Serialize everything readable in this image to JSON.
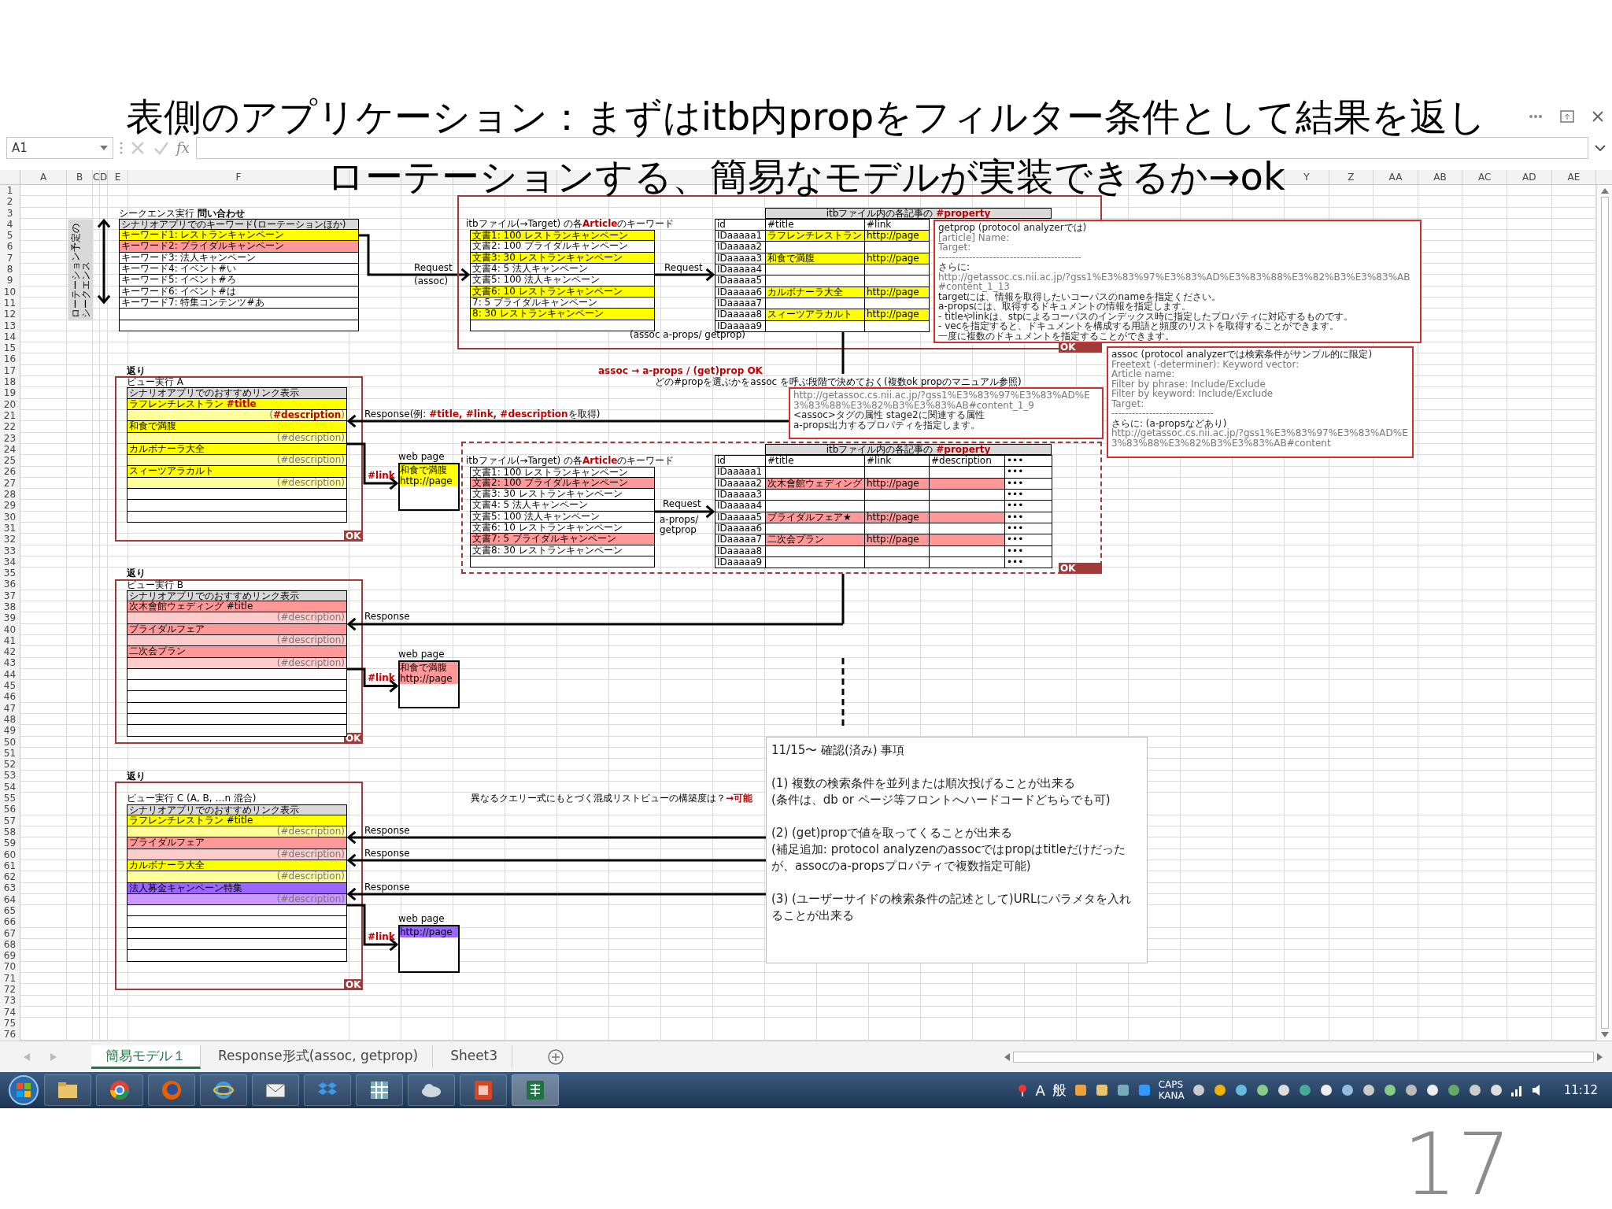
{
  "slide_title_lines": [
    "表側のアプリケーション：まずはitb内propをフィルター条件として結果を返し",
    "ローテーションする、簡易なモデルが実装できるか→ok"
  ],
  "name_box": "A1",
  "formula_fx": "fx",
  "column_headers_left": [
    "A",
    "B",
    "C",
    "D",
    "E",
    "F"
  ],
  "column_headers_right": [
    "Y",
    "Z",
    "AA",
    "AB",
    "AC",
    "AD",
    "AE"
  ],
  "row_numbers": [
    "1",
    "2",
    "3",
    "4",
    "5",
    "6",
    "7",
    "8",
    "9",
    "10",
    "11",
    "12",
    "13",
    "14",
    "15",
    "16",
    "17",
    "18",
    "19",
    "20",
    "21",
    "22",
    "23",
    "24",
    "25",
    "26",
    "27",
    "28",
    "29",
    "30",
    "31",
    "32",
    "33",
    "34",
    "35",
    "36",
    "37",
    "38",
    "39",
    "40",
    "41",
    "42",
    "43",
    "44",
    "45",
    "46",
    "47",
    "48",
    "49",
    "50",
    "51",
    "52",
    "53",
    "54",
    "55",
    "56",
    "57",
    "58",
    "59",
    "60",
    "61",
    "62",
    "63",
    "64",
    "65",
    "66",
    "67",
    "68",
    "69",
    "70",
    "71",
    "72",
    "73",
    "74",
    "75",
    "76"
  ],
  "sequence": {
    "heading": "シークエンス実行 **問い合わせ**",
    "rotation_label": "ローテーション予定のシークエンス",
    "request_labels": [
      "Request",
      "(assoc)"
    ],
    "rows": [
      {
        "kind": "header",
        "text": "シナリオアプリでのキーワード(ローテーションほか)"
      },
      {
        "kind": "item",
        "text": "キーワード1: レストランキャンペーン",
        "color": "#ffff00"
      },
      {
        "kind": "item",
        "text": "キーワード2: ブライダルキャンペーン",
        "color": "#ff9999"
      },
      {
        "kind": "item",
        "text": "キーワード3: 法人キャンペーン",
        "color": "#ffffff"
      },
      {
        "kind": "item",
        "text": "キーワード4: イベント#い",
        "color": "#ffffff"
      },
      {
        "kind": "item",
        "text": "キーワード5: イベント#ろ",
        "color": "#ffffff"
      },
      {
        "kind": "item",
        "text": "キーワード6: イベント#は",
        "color": "#ffffff"
      },
      {
        "kind": "item",
        "text": "キーワード7: 特集コンテンツ#あ",
        "color": "#ffffff"
      },
      {
        "kind": "empty"
      },
      {
        "kind": "empty"
      }
    ]
  },
  "assoc_note": {
    "lines": [
      {
        "kind": "label",
        "text": "assoc (protocol analyzerでは検索条件がサンプル的に限定)"
      },
      {
        "kind": "field",
        "text": "Freetext (-determiner): Keyword vector:"
      },
      {
        "kind": "field",
        "text": "Article name:"
      },
      {
        "kind": "field",
        "text": "Filter by phrase: Include/Exclude"
      },
      {
        "kind": "field",
        "text": "Filter by keyword: Include/Exclude"
      },
      {
        "kind": "field",
        "text": "Target:"
      },
      {
        "kind": "rule",
        "text": "------------------------------"
      },
      {
        "kind": "label",
        "text": "さらに: (a-propsなどあり)"
      },
      {
        "kind": "url",
        "text": "http://getassoc.cs.nii.ac.jp/?gss1%E3%83%97%E3%83%AD%E3%83%88%E3%82%B3%E3%83%AB#content"
      }
    ]
  },
  "stage_1": {
    "article_heading": "itbファイル(→Target) の各**Article**のキーワード",
    "articles": [
      {
        "kind": "item",
        "text": "文書1: 100 レストランキャンペーン",
        "color": "#ffff00"
      },
      {
        "kind": "item",
        "text": "文書2: 100 ブライダルキャンペーン",
        "color": "#ffffff"
      },
      {
        "kind": "item",
        "text": "文書3: 30 レストランキャンペーン",
        "color": "#ffff00"
      },
      {
        "kind": "item",
        "text": "文書4: 5 法人キャンペーン",
        "color": "#ffffff"
      },
      {
        "kind": "item",
        "text": "文書5: 100 法人キャンペーン",
        "color": "#ffffff"
      },
      {
        "kind": "item",
        "text": "文書6: 10 レストランキャンペーン",
        "color": "#ffff00"
      },
      {
        "kind": "item",
        "text": "7: 5 ブライダルキャンペーン",
        "color": "#ffffff"
      },
      {
        "kind": "item",
        "text": "8: 30 レストランキャンペーン",
        "color": "#ffff00"
      },
      {
        "kind": "empty"
      }
    ],
    "request_labels": [
      "Request"
    ],
    "property_heading": "itbファイル内の各記事の **#property**",
    "columns": [
      "id",
      "#title",
      "#link"
    ],
    "properties": [
      {
        "id": "IDaaaaa1",
        "title": "ラフレンチレストラン",
        "link": "http://page",
        "color": "#ffff00"
      },
      {
        "id": "IDaaaaa2",
        "color": "#ffffff"
      },
      {
        "id": "IDaaaaa3",
        "title": "和食で満腹",
        "link": "http://page",
        "color": "#ffff00"
      },
      {
        "id": "IDaaaaa4",
        "color": "#ffffff"
      },
      {
        "id": "IDaaaaa5",
        "color": "#ffffff"
      },
      {
        "id": "IDaaaaa6",
        "title": "カルボナーラ大全",
        "link": "http://page",
        "color": "#ffff00"
      },
      {
        "id": "IDaaaaa7",
        "color": "#ffffff"
      },
      {
        "id": "IDaaaaa8",
        "title": "スィーツアラカルト",
        "link": "http://page",
        "color": "#ffff00"
      },
      {
        "id": "IDaaaaa9",
        "color": "#ffffff"
      }
    ],
    "caption": "(assoc a-props/ getprop)",
    "status": "OK"
  },
  "getprop_note": {
    "lines": [
      {
        "kind": "label",
        "text": "getprop (protocol analyzerでは)"
      },
      {
        "kind": "field",
        "text": "[article] Name:"
      },
      {
        "kind": "field",
        "text": "Target:"
      },
      {
        "kind": "rule",
        "text": "------------------------------------------"
      },
      {
        "kind": "label",
        "text": "さらに:"
      },
      {
        "kind": "url",
        "text": "http://getassoc.cs.nii.ac.jp/?gss1%E3%83%97%E3%83%AD%E3%83%88%E3%82%B3%E3%83%AB#content_1_13"
      },
      {
        "kind": "label",
        "text": "targetには、情報を取得したいコーパスのnameを指定ください。"
      },
      {
        "kind": "label",
        "text": "a-propsには、取得するドキュメントの情報を指定します。"
      },
      {
        "kind": "label",
        "text": " - titleやlinkは、stpによるコーパスのインデックス時に指定したプロパティに対応するものです。"
      },
      {
        "kind": "label",
        "text": " - vecを指定すると、ドキュメントを構成する用語と頻度のリストを取得することができます。"
      },
      {
        "kind": "label",
        "text": "一度に複数のドキュメントを指定することができます。"
      }
    ]
  },
  "result_note": {
    "summary": "assoc → a-props / (get)prop OK",
    "detail": "どの#propを選ぶかをassoc を呼ぶ段階で決めておく(複数ok propのマニュアル参照)"
  },
  "stage2_note": {
    "lines": [
      {
        "kind": "url",
        "text": "http://getassoc.cs.nii.ac.jp/?gss1%E3%83%97%E3%83%AD%E3%83%88%E3%82%B3%E3%83%AB#content_1_9"
      },
      {
        "kind": "label",
        "text": "<assoc>タグの属性  stage2に関連する属性"
      },
      {
        "kind": "label",
        "text": "a-props出力するプロパティを指定します。"
      }
    ]
  },
  "stage_2": {
    "article_heading": "itbファイル(→Target) の各**Article**のキーワード",
    "articles": [
      {
        "kind": "item",
        "text": "文書1: 100 レストランキャンペーン",
        "color": "#ffffff"
      },
      {
        "kind": "item",
        "text": "文書2: 100 ブライダルキャンペーン",
        "color": "#ff9999"
      },
      {
        "kind": "item",
        "text": "文書3: 30 レストランキャンペーン",
        "color": "#ffffff"
      },
      {
        "kind": "item",
        "text": "文書4: 5 法人キャンペーン",
        "color": "#ffffff"
      },
      {
        "kind": "item",
        "text": "文書5: 100 法人キャンペーン",
        "color": "#ffffff"
      },
      {
        "kind": "item",
        "text": "文書6: 10 レストランキャンペーン",
        "color": "#ffffff"
      },
      {
        "kind": "item",
        "text": "文書7: 5 ブライダルキャンペーン",
        "color": "#ff9999"
      },
      {
        "kind": "item",
        "text": "文書8: 30 レストランキャンペーン",
        "color": "#ffffff"
      },
      {
        "kind": "empty"
      }
    ],
    "request_labels": [
      "Request",
      "a-props/ getprop"
    ],
    "property_heading": "itbファイル内の各記事の **#property**",
    "columns": [
      "id",
      "#title",
      "#link",
      "#description",
      "•••"
    ],
    "properties": [
      {
        "id": "IDaaaaa1",
        "more": "•••",
        "color": "#ffffff"
      },
      {
        "id": "IDaaaaa2",
        "title": "次木會館ウェディング",
        "link": "http://page",
        "more": "•••",
        "color": "#ff9999"
      },
      {
        "id": "IDaaaaa3",
        "more": "•••",
        "color": "#ffffff"
      },
      {
        "id": "IDaaaaa4",
        "more": "•••",
        "color": "#ffffff"
      },
      {
        "id": "IDaaaaa5",
        "title": "ブライダルフェア★",
        "link": "http://page",
        "more": "•••",
        "color": "#ff9999"
      },
      {
        "id": "IDaaaaa6",
        "more": "•••",
        "color": "#ffffff"
      },
      {
        "id": "IDaaaaa7",
        "title": "二次会プラン",
        "link": "http://page",
        "more": "•••",
        "color": "#ff9999"
      },
      {
        "id": "IDaaaaa8",
        "more": "•••",
        "color": "#ffffff"
      },
      {
        "id": "IDaaaaa9",
        "more": "•••",
        "color": "#ffffff"
      }
    ],
    "status": "OK"
  },
  "views": [
    {
      "returns_label": "返り",
      "title": "ビュー実行 A",
      "responses": [
        "Response(例: **#title, #link, #description**を取得)"
      ],
      "link_label": "#link",
      "status": "OK",
      "web_page": {
        "label": "web page",
        "color": "#ffff00",
        "lines": [
          "和食で満腹",
          "http://page"
        ]
      },
      "rows": [
        {
          "kind": "header",
          "text": "シナリオアプリでのおすすめリンク表示"
        },
        {
          "kind": "item",
          "text": "ラフレンチレストラン **#title**",
          "color": "#ffff00"
        },
        {
          "kind": "description",
          "text": "(**#description**)",
          "color": "#ffff99"
        },
        {
          "kind": "item",
          "text": "和食で満腹",
          "color": "#ffff00"
        },
        {
          "kind": "description",
          "text": "(#description)",
          "color": "#ffff99"
        },
        {
          "kind": "item",
          "text": "カルボナーラ大全",
          "color": "#ffff00"
        },
        {
          "kind": "description",
          "text": "(#description)",
          "color": "#ffff99"
        },
        {
          "kind": "item",
          "text": "スィーツアラカルト",
          "color": "#ffff00"
        },
        {
          "kind": "description",
          "text": "(#description)",
          "color": "#ffff99"
        },
        {
          "kind": "empty"
        },
        {
          "kind": "empty"
        },
        {
          "kind": "empty"
        }
      ]
    },
    {
      "returns_label": "返り",
      "title": "ビュー実行 B",
      "responses": [
        "Response"
      ],
      "link_label": "#link",
      "status": "OK",
      "web_page": {
        "label": "web page",
        "color": "#ff9999",
        "lines": [
          "和食で満腹",
          "http://page"
        ]
      },
      "rows": [
        {
          "kind": "header",
          "text": "シナリオアプリでのおすすめリンク表示"
        },
        {
          "kind": "item",
          "text": "次木會館ウェディング #title",
          "color": "#ff9999"
        },
        {
          "kind": "description",
          "text": "(#description)",
          "color": "#ffcccc"
        },
        {
          "kind": "item",
          "text": "ブライダルフェア",
          "color": "#ff9999"
        },
        {
          "kind": "description",
          "text": "(#description)",
          "color": "#ffcccc"
        },
        {
          "kind": "item",
          "text": "二次会プラン",
          "color": "#ff9999"
        },
        {
          "kind": "description",
          "text": "(#description)",
          "color": "#ffcccc"
        },
        {
          "kind": "empty"
        },
        {
          "kind": "empty"
        },
        {
          "kind": "empty"
        },
        {
          "kind": "empty"
        },
        {
          "kind": "empty"
        },
        {
          "kind": "empty"
        }
      ]
    },
    {
      "returns_label": "返り",
      "title": "ビュー実行 C (A, B, …n 混合)",
      "responses": [
        "Response",
        "Response",
        "Response"
      ],
      "link_label": "#link",
      "status": "OK",
      "query_note": "異なるクエリー式にもとづく混成リストビューの構築度は？**→可能**",
      "web_page": {
        "label": "web page",
        "color": "#9966ff",
        "lines": [
          "http://page"
        ]
      },
      "rows": [
        {
          "kind": "header",
          "text": "シナリオアプリでのおすすめリンク表示"
        },
        {
          "kind": "item",
          "text": "ラフレンチレストラン #title",
          "color": "#ffff00"
        },
        {
          "kind": "description",
          "text": "(#description)",
          "color": "#ffff99"
        },
        {
          "kind": "item",
          "text": "ブライダルフェア",
          "color": "#ff9999"
        },
        {
          "kind": "description",
          "text": "(#description)",
          "color": "#ffcccc"
        },
        {
          "kind": "item",
          "text": "カルボナーラ大全",
          "color": "#ffff00"
        },
        {
          "kind": "description",
          "text": "(#description)",
          "color": "#ffff99"
        },
        {
          "kind": "item",
          "text": "法人募金キャンペーン特集",
          "color": "#9966ff"
        },
        {
          "kind": "description",
          "text": "(#description)",
          "color": "#cc99ff"
        },
        {
          "kind": "empty"
        },
        {
          "kind": "empty"
        },
        {
          "kind": "empty"
        },
        {
          "kind": "empty"
        },
        {
          "kind": "empty"
        }
      ]
    }
  ],
  "confirm_box": {
    "title": "11/15〜  確認(済み) 事項",
    "items": [
      {
        "lines": [
          "(1) 複数の検索条件を並列または順次投げることが出来る",
          "(条件は、db or ページ等フロントへハードコードどちらでも可)"
        ]
      },
      {
        "lines": [
          "(2) (get)propで値を取ってくることが出来る",
          "(補足追加: protocol analyzenのassocではpropはtitleだけだったが、assocのa-propsプロパティで複数指定可能)"
        ]
      },
      {
        "lines": [
          "(3)  (ユーザーサイドの検索条件の記述として)URLにパラメタを入れることが出来る"
        ]
      }
    ]
  },
  "sheet_tabs": [
    {
      "label": "簡易モデル１",
      "selected": true
    },
    {
      "label": "Response形式(assoc, getprop)",
      "selected": false
    },
    {
      "label": "Sheet3",
      "selected": false
    }
  ],
  "taskbar": {
    "ime_mode": "A",
    "ime_input": "般",
    "caps": "CAPS",
    "kana": "KANA",
    "clock": "11:12"
  },
  "page_number": "17"
}
